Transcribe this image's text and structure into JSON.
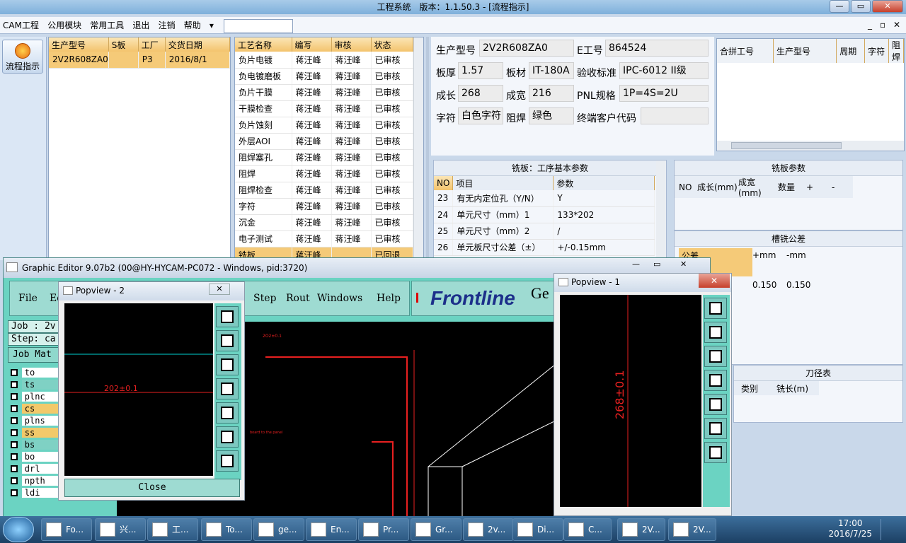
{
  "app": {
    "title": "工程系统　版本：1.1.50.3 - [流程指示]"
  },
  "menu": [
    "CAM工程",
    "公用模块",
    "常用工具",
    "退出",
    "注销",
    "帮助",
    "▾"
  ],
  "left": {
    "flow_label": "流程指示"
  },
  "job_grid": {
    "headers": [
      "生产型号",
      "S板",
      "工厂",
      "交货日期"
    ],
    "row": [
      "2V2R608ZA0",
      "",
      "P3",
      "2016/8/1"
    ]
  },
  "process_grid": {
    "headers": [
      "工艺名称",
      "编写",
      "审核",
      "状态"
    ],
    "rows": [
      [
        "负片电镀",
        "蒋汪峰",
        "蒋汪峰",
        "已审核"
      ],
      [
        "负电镀磨板",
        "蒋汪峰",
        "蒋汪峰",
        "已审核"
      ],
      [
        "负片干膜",
        "蒋汪峰",
        "蒋汪峰",
        "已审核"
      ],
      [
        "干膜检查",
        "蒋汪峰",
        "蒋汪峰",
        "已审核"
      ],
      [
        "负片蚀刻",
        "蒋汪峰",
        "蒋汪峰",
        "已审核"
      ],
      [
        "外层AOI",
        "蒋汪峰",
        "蒋汪峰",
        "已审核"
      ],
      [
        "阻焊塞孔",
        "蒋汪峰",
        "蒋汪峰",
        "已审核"
      ],
      [
        "阻焊",
        "蒋汪峰",
        "蒋汪峰",
        "已审核"
      ],
      [
        "阻焊检查",
        "蒋汪峰",
        "蒋汪峰",
        "已审核"
      ],
      [
        "字符",
        "蒋汪峰",
        "蒋汪峰",
        "已审核"
      ],
      [
        "沉金",
        "蒋汪峰",
        "蒋汪峰",
        "已审核"
      ],
      [
        "电子测试",
        "蒋汪峰",
        "蒋汪峰",
        "已审核"
      ],
      [
        "铣板",
        "蒋汪峰",
        "",
        "已回退"
      ]
    ]
  },
  "info": {
    "model_label": "生产型号",
    "model": "2V2R608ZA0",
    "eno_label": "E工号",
    "eno": "864524",
    "thick_label": "板厚",
    "thick": "1.57",
    "mat_label": "板材",
    "mat": "IT-180A",
    "std_label": "验收标准",
    "std": "IPC-6012 II级",
    "len_label": "成长",
    "len": "268",
    "wid_label": "成宽",
    "wid": "216",
    "pnl_label": "PNL规格",
    "pnl": "1P=4S=2U",
    "char_label": "字符",
    "char": "白色字符",
    "mask_label": "阻焊",
    "mask": "绿色",
    "cust_label": "终端客户代码",
    "cust": ""
  },
  "merge_grid": {
    "headers": [
      "合拼工号",
      "生产型号",
      "周期",
      "字符",
      "阻焊"
    ]
  },
  "mill_basic": {
    "title": "铣板：工序基本参数",
    "headers": [
      "NO",
      "项目",
      "参数"
    ],
    "rows": [
      [
        "23",
        "有无内定位孔（Y/N）",
        "Y"
      ],
      [
        "24",
        "单元尺寸（mm）1",
        "133*202"
      ],
      [
        "25",
        "单元尺寸（mm）2",
        "/"
      ],
      [
        "26",
        "单元板尺寸公差（±）",
        "+/-0.15mm"
      ]
    ]
  },
  "mill_params": {
    "title": "铣板参数",
    "headers": [
      "NO",
      "成长(mm)",
      "成宽(mm)",
      "数量",
      "+",
      "-"
    ]
  },
  "slot_tol": {
    "title": "槽铣公差",
    "headers": [
      "公差",
      "+mm",
      "-mm"
    ],
    "values": [
      "0.150",
      "0.150"
    ]
  },
  "tool_table": {
    "title": "刀径表",
    "headers": [
      "类别",
      "铣长(m)"
    ]
  },
  "graphic_editor": {
    "title": "Graphic Editor 9.07b2 (00@HY-HYCAM-PC072 - Windows, pid:3720)",
    "menu": [
      "File",
      "Ed",
      "Step",
      "Rout",
      "Windows",
      "Help"
    ],
    "brand": "Frontline",
    "brand_tail": "Ge",
    "job_label": "Job : 2v",
    "step_label": "Step: ca",
    "job_matrix": "Job Mat",
    "layers": [
      "to",
      "ts",
      "plnc",
      "cs",
      "plns",
      "ss",
      "bs",
      "bo",
      "drl",
      "npth",
      "ldi"
    ],
    "drawing_note": "2O2±0.1",
    "drawing_note2": "board to the panel"
  },
  "popview2": {
    "title": "Popview - 2",
    "dim": "202±0.1",
    "close": "Close"
  },
  "popview1": {
    "title": "Popview - 1",
    "dim": "268±0.1"
  },
  "taskbar": {
    "items": [
      "Fo...",
      "兴...",
      "工...",
      "To...",
      "ge...",
      "En...",
      "Pr...",
      "Gr...",
      "2v...",
      "Di...",
      "C...",
      "2V...",
      "2V..."
    ],
    "time": "17:00",
    "date": "2016/7/25"
  }
}
